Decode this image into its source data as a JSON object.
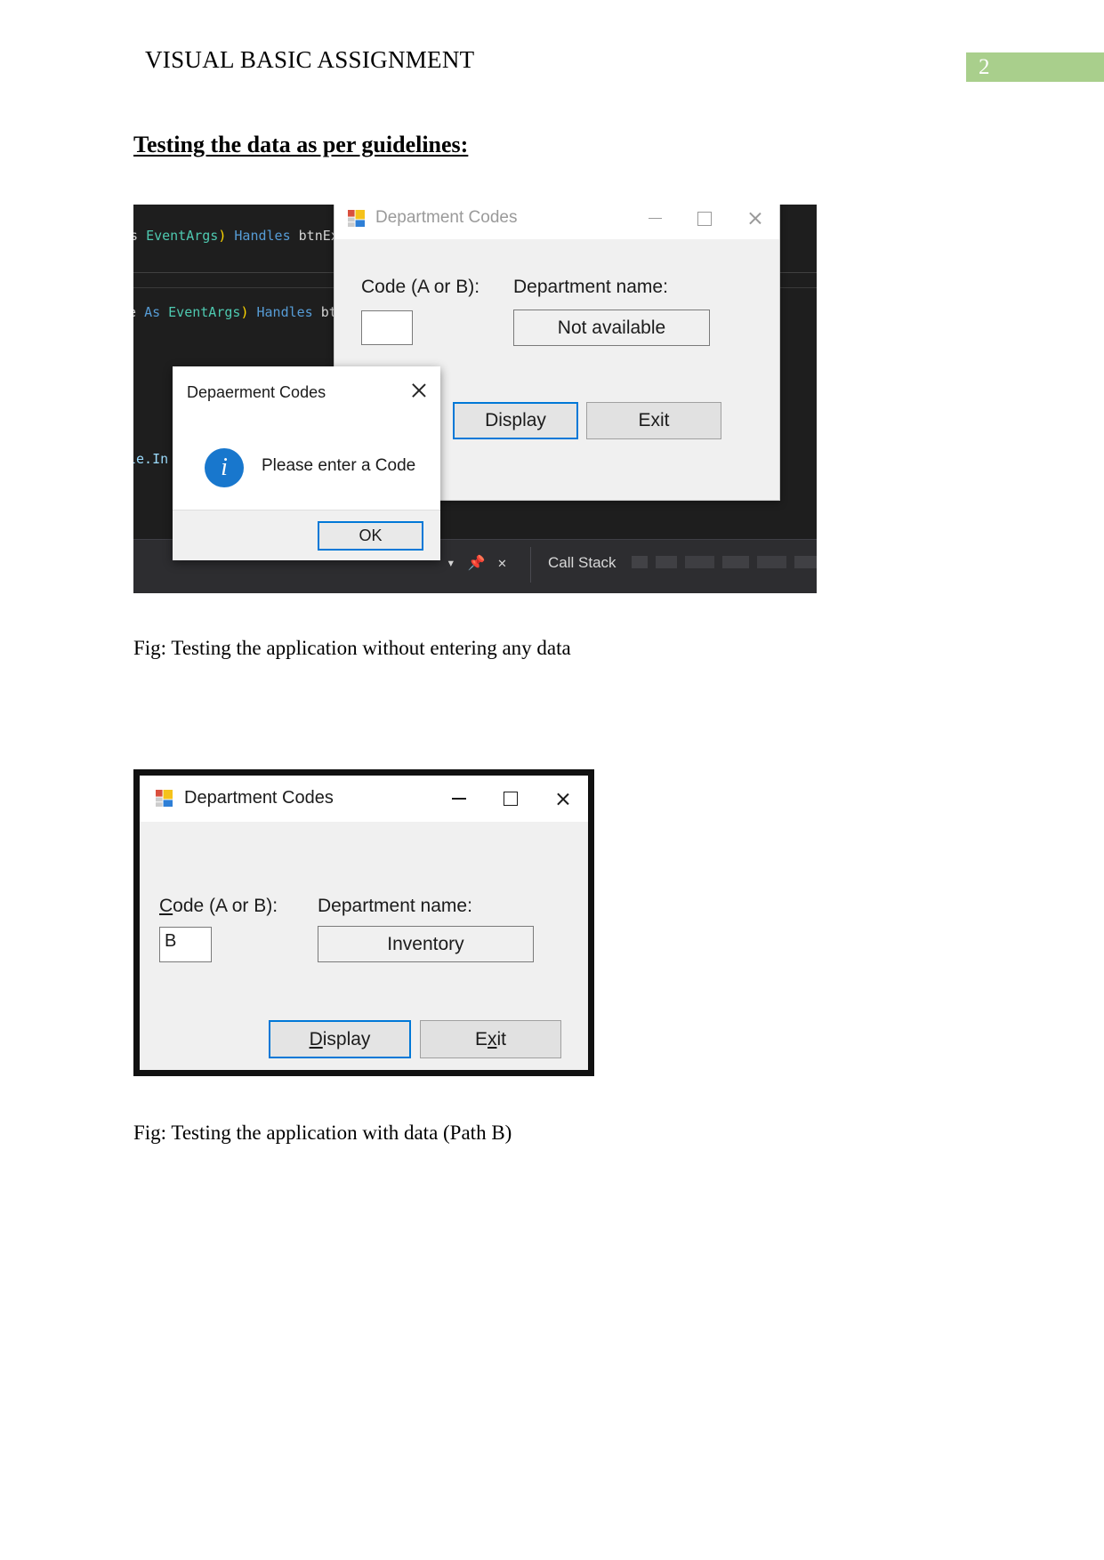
{
  "header": {
    "title": "VISUAL BASIC ASSIGNMENT",
    "page_number": "2",
    "badge_color": "#a9cf8c"
  },
  "section": {
    "heading": "Testing the data as per guidelines:"
  },
  "captions": {
    "figure_one": "Fig: Testing the application without entering any data",
    "figure_two": "Fig: Testing the application with data (Path B)"
  },
  "screenshot_one": {
    "ide": {
      "code_line_1": "s EventArgs) Handles btnExit.Click",
      "code_line_2": "e As EventArgs) Handles bt",
      "code_line_3": "le.In",
      "panel_dropdown_icon": "chevron-down-icon",
      "panel_pin_icon": "pin-icon",
      "panel_close_icon": "close-icon",
      "panel_tab_label": "Call Stack"
    },
    "form": {
      "app_icon": "vb-form-icon",
      "title": "Department Codes",
      "minimize_icon": "minimize-icon",
      "maximize_icon": "maximize-icon",
      "close_icon": "close-icon",
      "code_label": "Code (A or B):",
      "code_value": "",
      "department_label": "Department name:",
      "department_value": "Not available",
      "display_button": "Display",
      "exit_button": "Exit"
    },
    "message_box": {
      "title": "Depaerment Codes",
      "close_icon": "close-icon",
      "info_icon": "info-icon",
      "info_glyph": "i",
      "message": "Please enter a Code",
      "ok_button": "OK"
    }
  },
  "screenshot_two": {
    "form": {
      "app_icon": "vb-form-icon",
      "title": "Department Codes",
      "minimize_icon": "minimize-icon",
      "maximize_icon": "maximize-icon",
      "close_icon": "close-icon",
      "code_label_accel": "C",
      "code_label_rest": "ode (A or B):",
      "code_value": "B",
      "department_label": "Department name:",
      "department_value": "Inventory",
      "display_button_accel": "D",
      "display_button_rest": "isplay",
      "exit_button_pre": "E",
      "exit_button_accel": "x",
      "exit_button_post": "it"
    }
  }
}
